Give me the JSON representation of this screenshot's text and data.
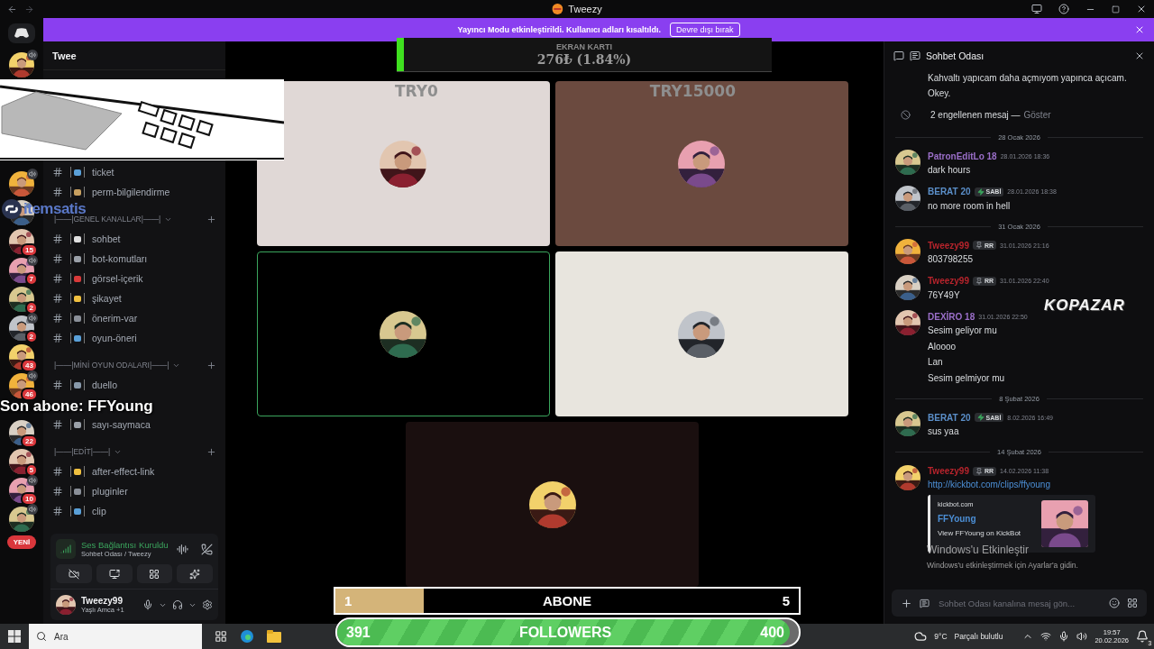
{
  "window": {
    "title": "Tweezy"
  },
  "banner": {
    "text": "Yayıncı Modu etkinleştirildi. Kullanıcı adları kısaltıldı.",
    "button": "Devre dışı bırak"
  },
  "rail": {
    "top_servers": [
      {
        "voice": true
      }
    ],
    "servers": [
      {
        "voice": true
      },
      {
        "voice": false
      },
      {
        "badge": "15",
        "voice": false
      },
      {
        "badge": "7",
        "voice": true
      },
      {
        "badge": "2",
        "voice": false
      },
      {
        "badge": "2",
        "voice": true
      },
      {
        "badge": "43",
        "voice": false
      },
      {
        "badge": "46",
        "voice": true
      },
      {
        "badge": "22",
        "voice": false
      },
      {
        "badge": "5",
        "voice": false
      },
      {
        "badge": "10",
        "voice": true
      },
      {
        "voice": true
      }
    ],
    "new_label": "YENİ"
  },
  "server": {
    "name": "Twee"
  },
  "channels": [
    {
      "kind": "channel",
      "name": "ticket"
    },
    {
      "kind": "channel",
      "name": "perm-bilgilendirme"
    },
    {
      "kind": "category",
      "name": "|——|GENEL KANALLAR|——|"
    },
    {
      "kind": "channel",
      "name": "sohbet"
    },
    {
      "kind": "channel",
      "name": "bot-komutları"
    },
    {
      "kind": "channel",
      "name": "görsel-içerik"
    },
    {
      "kind": "channel",
      "name": "şikayet"
    },
    {
      "kind": "channel",
      "name": "önerim-var"
    },
    {
      "kind": "channel",
      "name": "oyun-öneri"
    },
    {
      "kind": "category",
      "name": "|——|MİNİ OYUN ODALARI|——|"
    },
    {
      "kind": "channel",
      "name": "duello"
    },
    {
      "kind": "gap"
    },
    {
      "kind": "channel",
      "name": "sayı-saymaca"
    },
    {
      "kind": "category",
      "name": "|——|EDİT|——|"
    },
    {
      "kind": "channel",
      "name": "after-effect-link"
    },
    {
      "kind": "channel",
      "name": "pluginler"
    },
    {
      "kind": "channel",
      "name": "clip"
    }
  ],
  "voice_panel": {
    "status": "Ses Bağlantısı Kuruldu",
    "channel": "Sohbet Odası / Tweezy"
  },
  "user": {
    "name": "Tweezy99",
    "activity": "Yaşlı Amca +1"
  },
  "video_tiles": [
    {
      "color": "#e0d8d6",
      "speaking": false
    },
    {
      "color": "#6b4a3f",
      "speaking": false
    },
    {
      "color": "#000000",
      "speaking": true
    },
    {
      "color": "#e8e5de",
      "speaking": false
    },
    {
      "color": "#1a0f0f",
      "speaking": false
    }
  ],
  "donation_goal": {
    "title": "EKRAN KARTI",
    "amount": "276₺ (1.84%)",
    "level": 0.0184,
    "min_label": "TRY0",
    "max_label": "TRY15000"
  },
  "subscriber_goal": {
    "current": "1",
    "label": "ABONE",
    "target": "5",
    "level": 0.19
  },
  "follower_goal": {
    "current": "391",
    "label": "FOLLOWERS",
    "target": "400",
    "level": 0.98
  },
  "last_subscriber": "Son abone: FFYoung",
  "sponsors": [
    "itemsatis",
    "KOPAZAR"
  ],
  "chat": {
    "title": "Sohbet Odası",
    "items": [
      {
        "kind": "text",
        "text": "Kahvaltı yapıcam daha açmıyom yapınca açıcam."
      },
      {
        "kind": "text",
        "text": "Okey."
      },
      {
        "kind": "blocked",
        "text": "2 engellenen mesaj —",
        "action": "Göster"
      },
      {
        "kind": "divider",
        "text": "28 Ocak 2026"
      },
      {
        "kind": "message",
        "author": "PatronEditLo 18",
        "color": "#9b6fc9",
        "time": "28.01.2026 18:36",
        "lines": [
          "dark hours"
        ]
      },
      {
        "kind": "message",
        "author": "BERAT 20",
        "color": "#5b8fc9",
        "badge": {
          "kind": "bolt",
          "label": "SABİ"
        },
        "time": "28.01.2026 18:38",
        "lines": [
          "no more room in hell"
        ]
      },
      {
        "kind": "divider",
        "text": "31 Ocak 2026"
      },
      {
        "kind": "message",
        "author": "Tweezy99",
        "color": "#b8242c",
        "badge": {
          "kind": "pin",
          "label": "RR"
        },
        "time": "31.01.2026 21:16",
        "lines": [
          "803798255"
        ]
      },
      {
        "kind": "message",
        "author": "Tweezy99",
        "color": "#b8242c",
        "badge": {
          "kind": "pin",
          "label": "RR"
        },
        "time": "31.01.2026 22:40",
        "lines": [
          "76Y49Y"
        ]
      },
      {
        "kind": "message",
        "author": "DEXİRO 18",
        "color": "#9b6fc9",
        "time": "31.01.2026 22:50",
        "lines": [
          "Sesim geliyor mu",
          "Aloooo",
          "Lan",
          "Sesim gelmiyor mu"
        ]
      },
      {
        "kind": "divider",
        "text": "8 Şubat 2026"
      },
      {
        "kind": "message",
        "author": "BERAT 20",
        "color": "#5b8fc9",
        "badge": {
          "kind": "bolt",
          "label": "SABİ"
        },
        "time": "8.02.2026 16:49",
        "lines": [
          "sus yaa"
        ]
      },
      {
        "kind": "divider",
        "text": "14 Şubat 2026"
      },
      {
        "kind": "message",
        "author": "Tweezy99",
        "color": "#b8242c",
        "badge": {
          "kind": "pin",
          "label": "RR"
        },
        "time": "14.02.2026 11:38",
        "link": "http://kickbot.com/clips/ffyoung",
        "embed": {
          "site": "kickbot.com",
          "title": "FFYoung",
          "text": "View FFYoung on KickBot"
        }
      }
    ],
    "placeholder": "Sohbet Odası kanalına mesaj gön..."
  },
  "windows_activation": {
    "title": "Windows'u Etkinleştir",
    "text": "Windows'u etkinleştirmek için Ayarlar'a gidin."
  },
  "taskbar": {
    "search": "Ara",
    "temperature": "9°C",
    "weather": "Parçalı bulutlu",
    "time": "19:57",
    "date": "20.02.2026",
    "notifications": "3"
  }
}
